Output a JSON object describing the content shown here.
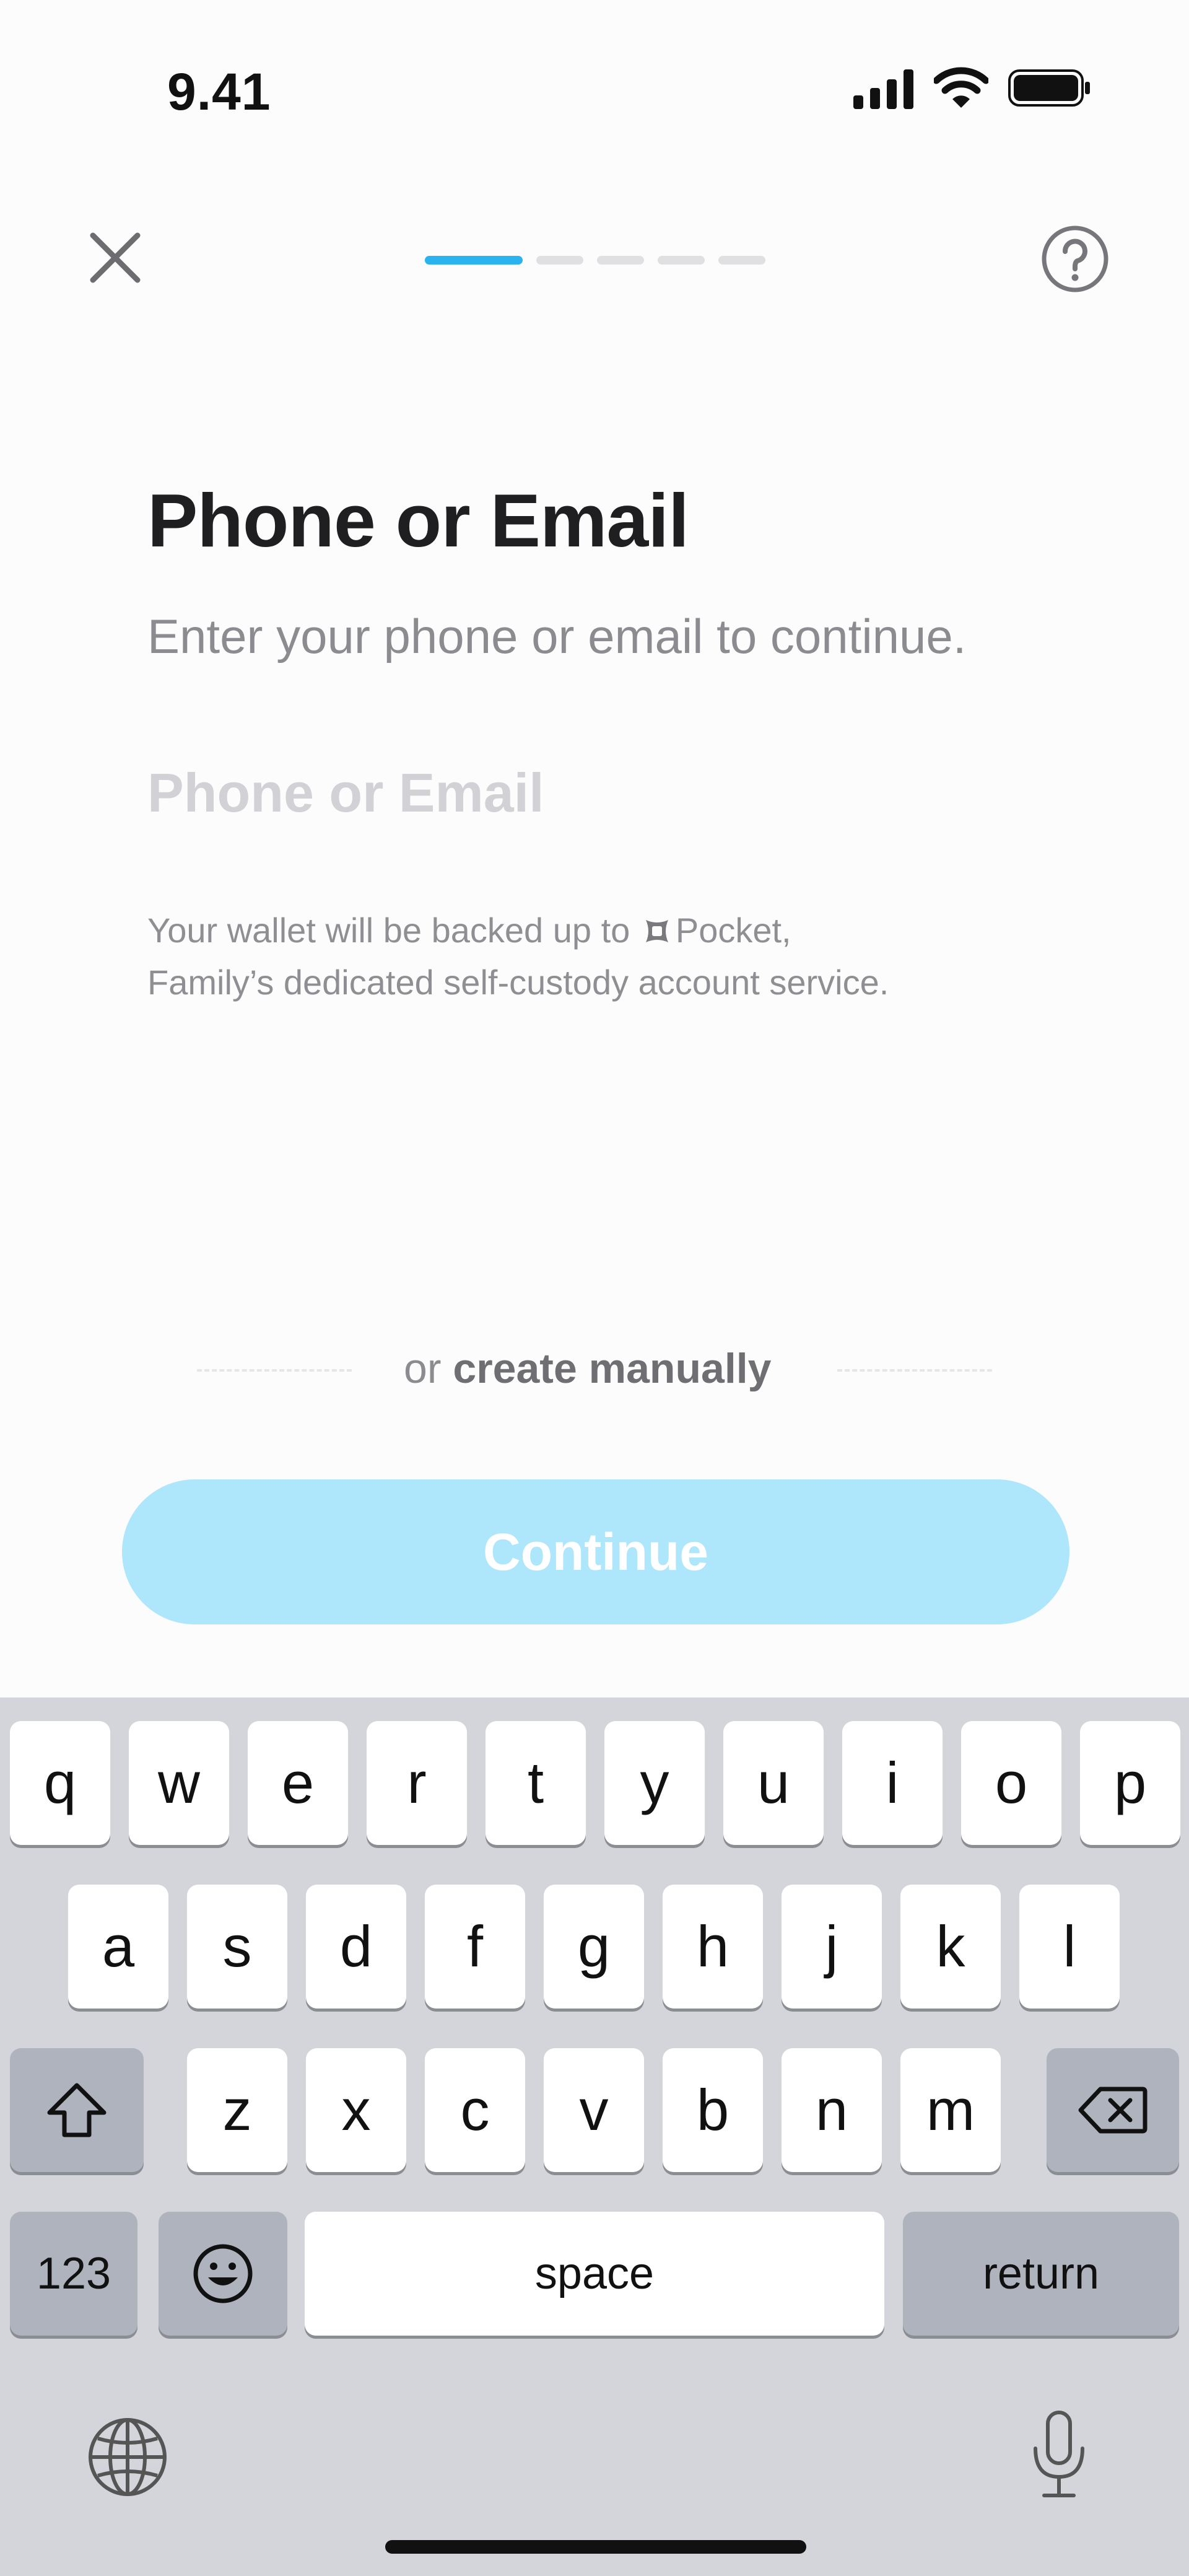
{
  "status_bar": {
    "time": "9.41",
    "icons": [
      "cellular-signal-icon",
      "wifi-icon",
      "battery-icon"
    ]
  },
  "header": {
    "close_icon": "close-icon",
    "help_icon": "help-icon",
    "progress": {
      "total_steps": 5,
      "current_step": 1,
      "active_color": "#2ab3ee"
    }
  },
  "content": {
    "title": "Phone or Email",
    "subtitle": "Enter your phone or email to continue.",
    "input": {
      "placeholder": "Phone or Email",
      "value": ""
    },
    "note_line1_prefix": "Your wallet will be backed up to",
    "note_brand": "Pocket,",
    "note_line2": "Family’s dedicated self-custody account service."
  },
  "alt_option": {
    "or_text": "or",
    "link_text": "create manually"
  },
  "continue_button": {
    "label": "Continue",
    "enabled": false,
    "color": "#aee6fb"
  },
  "keyboard": {
    "row1": [
      "q",
      "w",
      "e",
      "r",
      "t",
      "y",
      "u",
      "i",
      "o",
      "p"
    ],
    "row2": [
      "a",
      "s",
      "d",
      "f",
      "g",
      "h",
      "j",
      "k",
      "l"
    ],
    "row3": [
      "z",
      "x",
      "c",
      "v",
      "b",
      "n",
      "m"
    ],
    "numbers_label": "123",
    "space_label": "space",
    "return_label": "return",
    "icons": [
      "shift-icon",
      "backspace-icon",
      "emoji-icon",
      "globe-icon",
      "microphone-icon"
    ]
  }
}
